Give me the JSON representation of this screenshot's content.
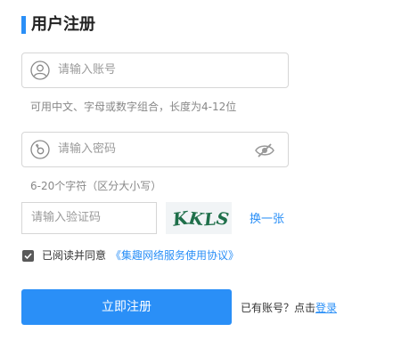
{
  "header": {
    "title": "用户注册"
  },
  "account": {
    "placeholder": "请输入账号",
    "hint": "可用中文、字母或数字组合，长度为4-12位"
  },
  "password": {
    "placeholder": "请输入密码",
    "hint": "6-20个字符（区分大小写）"
  },
  "captcha": {
    "placeholder": "请输入验证码",
    "code": "KKLS",
    "refresh_label": "换一张"
  },
  "agreement": {
    "checked": true,
    "text": "已阅读并同意",
    "link": "《集趣网络服务使用协议》"
  },
  "submit": {
    "label": "立即注册"
  },
  "login": {
    "prompt": "已有账号？点击",
    "link": "登录"
  },
  "colors": {
    "accent": "#2a8ff7",
    "border": "#d6d6d6",
    "captcha_text": "#1f6f4a"
  },
  "icons": {
    "account": "user-icon",
    "password": "key-icon",
    "toggle": "eye-off-icon",
    "agreement": "checkbox-checked-icon"
  }
}
